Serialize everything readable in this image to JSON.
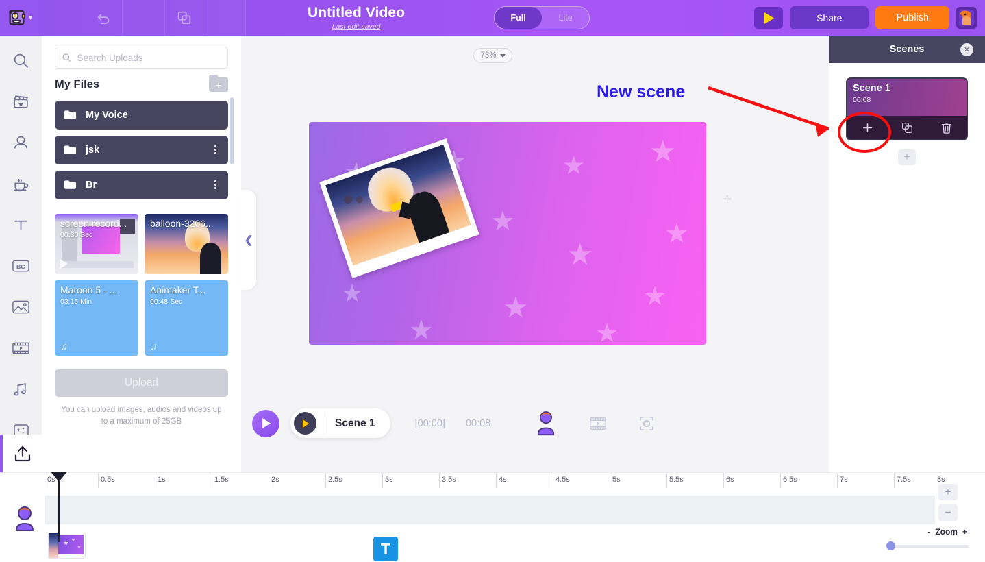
{
  "header": {
    "logo_icon": "animaker-monster-logo",
    "dropdown_icon": "chevron-down-icon",
    "undo_icon": "undo-icon",
    "copy_icon": "duplicate-icon",
    "title": "Untitled Video",
    "subtitle": "Last edit saved",
    "mode_full": "Full",
    "mode_lite": "Lite",
    "play_icon": "play-icon",
    "share_label": "Share",
    "publish_label": "Publish",
    "avatar_icon": "user-avatar"
  },
  "rail": {
    "items": [
      {
        "icon": "search-icon",
        "name": "sidebar-item-search"
      },
      {
        "icon": "clapperboard-icon",
        "name": "sidebar-item-scenes"
      },
      {
        "icon": "character-icon",
        "name": "sidebar-item-characters"
      },
      {
        "icon": "props-icon",
        "name": "sidebar-item-props"
      },
      {
        "icon": "text-icon",
        "name": "sidebar-item-text",
        "glyph": "T"
      },
      {
        "icon": "bg-icon",
        "name": "sidebar-item-background",
        "glyph": "BG"
      },
      {
        "icon": "image-icon",
        "name": "sidebar-item-images"
      },
      {
        "icon": "video-icon",
        "name": "sidebar-item-videos"
      },
      {
        "icon": "music-icon",
        "name": "sidebar-item-music"
      },
      {
        "icon": "effects-icon",
        "name": "sidebar-item-effects"
      }
    ],
    "upload_icon": "upload-icon",
    "user_icon": "user-avatar-icon"
  },
  "uploads": {
    "search_placeholder": "Search Uploads",
    "search_value": "",
    "search_icon": "search-icon",
    "files_title": "My Files",
    "new_folder_icon": "new-folder-icon",
    "folders": [
      {
        "name": "My Voice",
        "has_menu": false
      },
      {
        "name": "jsk",
        "has_menu": true
      },
      {
        "name": "Br",
        "has_menu": true
      }
    ],
    "media": [
      {
        "name": "screen record...",
        "duration": "00:30 Sec",
        "type": "video"
      },
      {
        "name": "balloon-3206...",
        "duration": "",
        "type": "video"
      },
      {
        "name": "Maroon 5 - ...",
        "duration": "03:15 Min",
        "type": "audio"
      },
      {
        "name": "Animaker T...",
        "duration": "00:48 Sec",
        "type": "audio"
      }
    ],
    "upload_label": "Upload",
    "upload_hint": "You can upload images, audios and videos up to a maximum of 25GB",
    "collapse_icon": "chevron-left-icon"
  },
  "canvas": {
    "zoom_level": "73%",
    "zoom_caret_icon": "caret-down-icon",
    "add_placeholder_icon": "plus-icon",
    "annotation_text": "New scene",
    "annotation_arrow_color": "#f80f0f",
    "annotation_text_color": "#2b19f0",
    "gradient_from": "#9b6ae6",
    "gradient_to": "#fa61f3"
  },
  "scenes": {
    "title": "Scenes",
    "close_icon": "close-icon",
    "cards": [
      {
        "name": "Scene 1",
        "duration": "00:08"
      }
    ],
    "tools": [
      {
        "icon": "plus-icon",
        "name": "add-scene-button"
      },
      {
        "icon": "duplicate-icon",
        "name": "duplicate-scene-button"
      },
      {
        "icon": "trash-icon",
        "name": "delete-scene-button"
      }
    ],
    "add_below_icon": "plus-icon"
  },
  "player": {
    "play_icon": "play-icon",
    "scene_label": "Scene 1",
    "current_time": "[00:00]",
    "total_time": "00:08",
    "character_icon": "character-icon",
    "video_icon": "video-icon",
    "crop_icon": "crop-icon"
  },
  "timeline": {
    "ticks": [
      "0s",
      "0.5s",
      "1s",
      "1.5s",
      "2s",
      "2.5s",
      "3s",
      "3.5s",
      "4s",
      "4.5s",
      "5s",
      "5.5s",
      "6s",
      "6.5s",
      "7s",
      "7.5s",
      "8s"
    ],
    "playhead_time": "0s",
    "clips": [
      {
        "type": "image",
        "name": "scene-thumbnail-clip"
      },
      {
        "type": "text",
        "glyph": "T",
        "name": "text-clip"
      }
    ],
    "zoom_in_icon": "plus-icon",
    "zoom_out_icon": "minus-icon",
    "zoom_minus": "-",
    "zoom_label": "Zoom",
    "zoom_plus": "+",
    "zoom_value": 0
  }
}
